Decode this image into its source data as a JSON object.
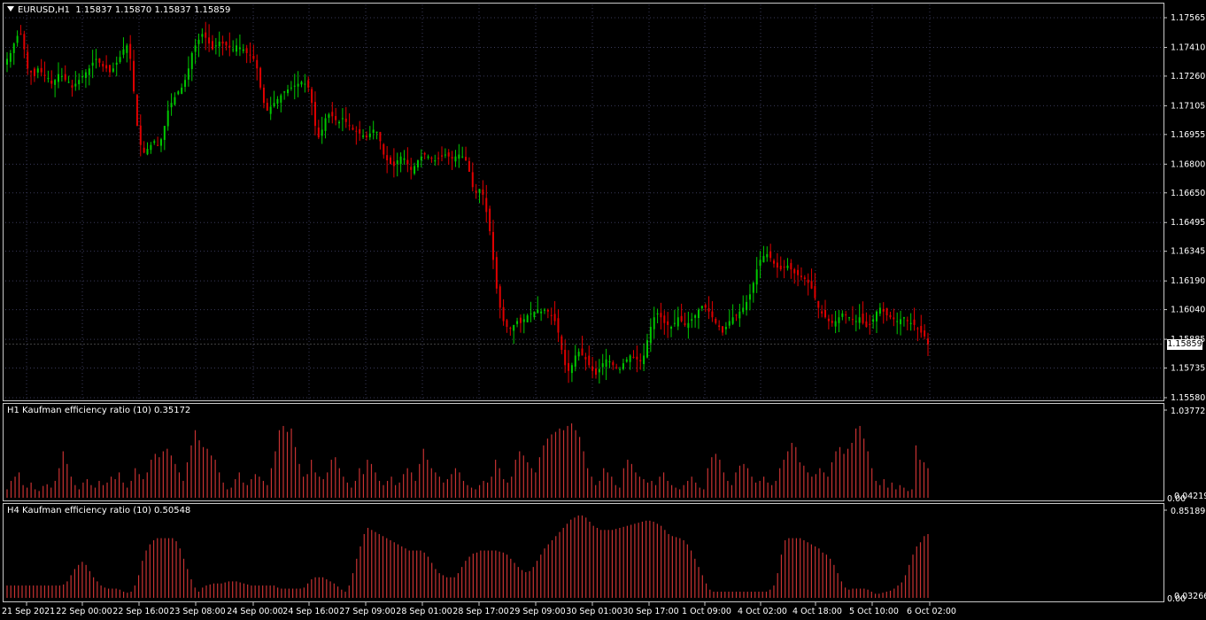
{
  "header": {
    "symbol_label": "EURUSD,H1",
    "ohlc": "1.15837 1.15870 1.15837 1.15859"
  },
  "current_price": "1.15859",
  "colors": {
    "bull": "#00c800",
    "bear": "#e00000",
    "ratio": "#c83232",
    "grid": "#3a3a5a",
    "border": "#c8c8c8"
  },
  "chart_data": [
    {
      "type": "line",
      "title": "EURUSD,H1",
      "ylim": [
        1.1558,
        1.1762
      ],
      "y_ticks": [
        "1.17565",
        "1.17410",
        "1.17260",
        "1.17105",
        "1.16955",
        "1.16800",
        "1.16650",
        "1.16495",
        "1.16345",
        "1.16190",
        "1.16040",
        "1.15885",
        "1.15735",
        "1.15580"
      ],
      "x_ticks": [
        "21 Sep 2021",
        "22 Sep 00:00",
        "22 Sep 16:00",
        "23 Sep 08:00",
        "24 Sep 00:00",
        "24 Sep 16:00",
        "27 Sep 09:00",
        "28 Sep 01:00",
        "28 Sep 17:00",
        "29 Sep 09:00",
        "30 Sep 01:00",
        "30 Sep 17:00",
        "1 Oct 09:00",
        "4 Oct 02:00",
        "4 Oct 18:00",
        "5 Oct 10:00",
        "6 Oct 02:00"
      ],
      "close_path": [
        1.1735,
        1.1738,
        1.1743,
        1.1747,
        1.1748,
        1.174,
        1.173,
        1.1728,
        1.1726,
        1.173,
        1.1728,
        1.1726,
        1.1725,
        1.1722,
        1.1724,
        1.1727,
        1.1726,
        1.1724,
        1.1723,
        1.172,
        1.1722,
        1.1724,
        1.1726,
        1.1728,
        1.173,
        1.1733,
        1.1735,
        1.1733,
        1.1731,
        1.173,
        1.1728,
        1.173,
        1.1733,
        1.1736,
        1.174,
        1.1742,
        1.1735,
        1.1718,
        1.17,
        1.169,
        1.1686,
        1.1688,
        1.169,
        1.1692,
        1.169,
        1.1693,
        1.17,
        1.1708,
        1.1712,
        1.1715,
        1.1718,
        1.172,
        1.1724,
        1.173,
        1.1738,
        1.1742,
        1.1745,
        1.1748,
        1.1746,
        1.1743,
        1.174,
        1.1742,
        1.1744,
        1.1743,
        1.1742,
        1.1741,
        1.174,
        1.1742,
        1.1741,
        1.174,
        1.1738,
        1.1737,
        1.1735,
        1.173,
        1.172,
        1.1712,
        1.1708,
        1.171,
        1.1712,
        1.1714,
        1.1716,
        1.1718,
        1.1719,
        1.172,
        1.1721,
        1.1722,
        1.1723,
        1.1722,
        1.172,
        1.1712,
        1.17,
        1.1694,
        1.1698,
        1.1704,
        1.1706,
        1.1705,
        1.1703,
        1.1702,
        1.1704,
        1.1702,
        1.17,
        1.1698,
        1.1697,
        1.1696,
        1.1695,
        1.1694,
        1.1696,
        1.1698,
        1.1697,
        1.1692,
        1.1685,
        1.1682,
        1.168,
        1.1679,
        1.1682,
        1.1684,
        1.1683,
        1.168,
        1.1677,
        1.1679,
        1.1682,
        1.1684,
        1.1685,
        1.1684,
        1.1683,
        1.1682,
        1.1683,
        1.1684,
        1.1685,
        1.1684,
        1.1683,
        1.1684,
        1.1685,
        1.1684,
        1.1682,
        1.1676,
        1.1668,
        1.1665,
        1.1667,
        1.1664,
        1.1655,
        1.1645,
        1.163,
        1.1615,
        1.1605,
        1.1598,
        1.1595,
        1.1594,
        1.1596,
        1.1598,
        1.1597,
        1.1599,
        1.1601,
        1.1602,
        1.1603,
        1.1604,
        1.1603,
        1.1604,
        1.1603,
        1.1601,
        1.1598,
        1.1592,
        1.1583,
        1.1575,
        1.1572,
        1.1575,
        1.158,
        1.1582,
        1.158,
        1.1578,
        1.1575,
        1.1572,
        1.157,
        1.1573,
        1.1576,
        1.1578,
        1.1577,
        1.1575,
        1.1574,
        1.1573,
        1.1576,
        1.1578,
        1.158,
        1.1579,
        1.1578,
        1.1577,
        1.158,
        1.1588,
        1.1595,
        1.16,
        1.1602,
        1.16,
        1.1597,
        1.1596,
        1.1595,
        1.1597,
        1.16,
        1.1598,
        1.1596,
        1.1597,
        1.1599,
        1.1601,
        1.1604,
        1.1606,
        1.1605,
        1.1603,
        1.16,
        1.1597,
        1.1595,
        1.1592,
        1.1595,
        1.1598,
        1.16,
        1.1601,
        1.1603,
        1.1605,
        1.1608,
        1.1612,
        1.1618,
        1.1625,
        1.163,
        1.1632,
        1.1633,
        1.1631,
        1.1628,
        1.1626,
        1.1625,
        1.1626,
        1.1627,
        1.1625,
        1.1623,
        1.1622,
        1.1621,
        1.162,
        1.1618,
        1.1615,
        1.161,
        1.1605,
        1.1602,
        1.16,
        1.1598,
        1.1597,
        1.1598,
        1.16,
        1.1602,
        1.1601,
        1.16,
        1.1599,
        1.1598,
        1.16,
        1.1597,
        1.1595,
        1.1596,
        1.1599,
        1.1603,
        1.1605,
        1.1603,
        1.1601,
        1.16,
        1.1599,
        1.1598,
        1.1599,
        1.16,
        1.1598,
        1.1597,
        1.1596,
        1.1594,
        1.1592,
        1.159,
        1.15859
      ]
    },
    {
      "type": "bar",
      "title": "H1 Kaufman efficiency ratio (10) 0.35172",
      "label": "H1 Kaufman efficiency ratio (10) 0.35172",
      "ylim": [
        0,
        1.03772
      ],
      "y_ticks": [
        "1.03772",
        "0.04219",
        "0.00"
      ],
      "values": [
        0.1,
        0.2,
        0.25,
        0.3,
        0.15,
        0.12,
        0.18,
        0.1,
        0.08,
        0.14,
        0.16,
        0.12,
        0.2,
        0.35,
        0.55,
        0.4,
        0.25,
        0.15,
        0.1,
        0.18,
        0.22,
        0.15,
        0.12,
        0.2,
        0.15,
        0.18,
        0.25,
        0.22,
        0.3,
        0.18,
        0.12,
        0.2,
        0.35,
        0.28,
        0.22,
        0.3,
        0.45,
        0.52,
        0.48,
        0.55,
        0.58,
        0.5,
        0.4,
        0.3,
        0.2,
        0.42,
        0.62,
        0.8,
        0.68,
        0.6,
        0.58,
        0.5,
        0.45,
        0.3,
        0.18,
        0.1,
        0.12,
        0.22,
        0.3,
        0.18,
        0.15,
        0.22,
        0.28,
        0.25,
        0.2,
        0.15,
        0.35,
        0.55,
        0.8,
        0.85,
        0.78,
        0.82,
        0.6,
        0.4,
        0.25,
        0.28,
        0.45,
        0.3,
        0.25,
        0.22,
        0.3,
        0.45,
        0.48,
        0.35,
        0.25,
        0.18,
        0.12,
        0.2,
        0.35,
        0.28,
        0.45,
        0.4,
        0.3,
        0.2,
        0.15,
        0.2,
        0.25,
        0.15,
        0.18,
        0.28,
        0.35,
        0.3,
        0.2,
        0.4,
        0.58,
        0.45,
        0.35,
        0.3,
        0.25,
        0.18,
        0.22,
        0.28,
        0.35,
        0.3,
        0.2,
        0.15,
        0.12,
        0.1,
        0.15,
        0.2,
        0.18,
        0.25,
        0.45,
        0.35,
        0.22,
        0.18,
        0.25,
        0.45,
        0.55,
        0.5,
        0.42,
        0.35,
        0.3,
        0.48,
        0.62,
        0.7,
        0.75,
        0.78,
        0.82,
        0.8,
        0.85,
        0.88,
        0.8,
        0.72,
        0.55,
        0.35,
        0.25,
        0.15,
        0.2,
        0.35,
        0.3,
        0.25,
        0.15,
        0.12,
        0.35,
        0.45,
        0.4,
        0.3,
        0.25,
        0.22,
        0.18,
        0.2,
        0.15,
        0.25,
        0.3,
        0.2,
        0.15,
        0.12,
        0.1,
        0.15,
        0.2,
        0.25,
        0.18,
        0.12,
        0.1,
        0.35,
        0.48,
        0.52,
        0.45,
        0.3,
        0.2,
        0.15,
        0.3,
        0.38,
        0.4,
        0.35,
        0.25,
        0.18,
        0.2,
        0.25,
        0.18,
        0.15,
        0.2,
        0.35,
        0.45,
        0.55,
        0.65,
        0.6,
        0.42,
        0.38,
        0.3,
        0.25,
        0.28,
        0.35,
        0.3,
        0.25,
        0.42,
        0.55,
        0.6,
        0.52,
        0.58,
        0.65,
        0.82,
        0.85,
        0.7,
        0.55,
        0.35,
        0.2,
        0.15,
        0.22,
        0.12,
        0.18,
        0.1,
        0.15,
        0.12,
        0.08,
        0.1,
        0.62,
        0.45,
        0.42,
        0.35
      ],
      "fill": "#c83232"
    },
    {
      "type": "bar",
      "title": "H4 Kaufman efficiency ratio (10) 0.50548",
      "label": "H4 Kaufman efficiency ratio (10) 0.50548",
      "ylim": [
        0,
        0.85189
      ],
      "y_ticks": [
        "0.85189",
        "0.03266",
        "0.00"
      ],
      "values": [
        0.12,
        0.12,
        0.12,
        0.12,
        0.12,
        0.12,
        0.12,
        0.12,
        0.12,
        0.12,
        0.12,
        0.12,
        0.12,
        0.12,
        0.12,
        0.13,
        0.16,
        0.22,
        0.28,
        0.32,
        0.35,
        0.32,
        0.26,
        0.2,
        0.16,
        0.12,
        0.1,
        0.09,
        0.09,
        0.09,
        0.08,
        0.06,
        0.05,
        0.06,
        0.12,
        0.22,
        0.36,
        0.46,
        0.52,
        0.56,
        0.58,
        0.58,
        0.58,
        0.58,
        0.58,
        0.55,
        0.48,
        0.38,
        0.28,
        0.18,
        0.1,
        0.06,
        0.1,
        0.12,
        0.13,
        0.14,
        0.14,
        0.14,
        0.15,
        0.16,
        0.16,
        0.16,
        0.15,
        0.14,
        0.13,
        0.12,
        0.12,
        0.12,
        0.12,
        0.12,
        0.12,
        0.12,
        0.1,
        0.09,
        0.09,
        0.09,
        0.09,
        0.09,
        0.09,
        0.1,
        0.14,
        0.18,
        0.2,
        0.2,
        0.2,
        0.18,
        0.16,
        0.14,
        0.11,
        0.08,
        0.06,
        0.12,
        0.24,
        0.38,
        0.5,
        0.62,
        0.68,
        0.66,
        0.64,
        0.62,
        0.6,
        0.58,
        0.56,
        0.54,
        0.52,
        0.5,
        0.48,
        0.46,
        0.46,
        0.46,
        0.46,
        0.44,
        0.4,
        0.34,
        0.28,
        0.24,
        0.22,
        0.2,
        0.2,
        0.2,
        0.24,
        0.3,
        0.36,
        0.4,
        0.43,
        0.44,
        0.46,
        0.46,
        0.46,
        0.46,
        0.46,
        0.45,
        0.44,
        0.42,
        0.38,
        0.34,
        0.3,
        0.27,
        0.25,
        0.26,
        0.3,
        0.36,
        0.42,
        0.48,
        0.52,
        0.56,
        0.6,
        0.64,
        0.68,
        0.72,
        0.76,
        0.78,
        0.8,
        0.8,
        0.78,
        0.74,
        0.7,
        0.68,
        0.66,
        0.66,
        0.66,
        0.66,
        0.67,
        0.68,
        0.69,
        0.7,
        0.71,
        0.72,
        0.73,
        0.74,
        0.75,
        0.75,
        0.74,
        0.72,
        0.7,
        0.66,
        0.62,
        0.6,
        0.59,
        0.58,
        0.56,
        0.52,
        0.46,
        0.38,
        0.3,
        0.22,
        0.14,
        0.08,
        0.06,
        0.06,
        0.06,
        0.06,
        0.06,
        0.06,
        0.06,
        0.06,
        0.06,
        0.06,
        0.06,
        0.06,
        0.06,
        0.06,
        0.06,
        0.08,
        0.12,
        0.24,
        0.42,
        0.56,
        0.58,
        0.58,
        0.58,
        0.58,
        0.56,
        0.54,
        0.52,
        0.5,
        0.48,
        0.44,
        0.42,
        0.38,
        0.32,
        0.24,
        0.16,
        0.1,
        0.08,
        0.09,
        0.09,
        0.09,
        0.09,
        0.08,
        0.06,
        0.04,
        0.04,
        0.05,
        0.06,
        0.07,
        0.09,
        0.12,
        0.15,
        0.22,
        0.32,
        0.42,
        0.5,
        0.54,
        0.6,
        0.62
      ],
      "fill": "#c83232"
    }
  ]
}
